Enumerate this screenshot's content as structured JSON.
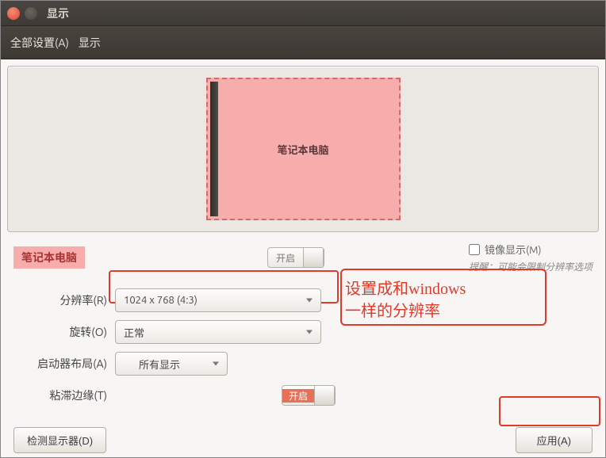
{
  "window": {
    "title": "显示"
  },
  "breadcrumb": {
    "all_settings": "全部设置(A)",
    "current": "显示"
  },
  "preview": {
    "monitor_name": "笔记本电脑"
  },
  "monitor_section": {
    "name": "笔记本电脑",
    "power_label": "开启",
    "mirror_label": "镜像显示(M)",
    "mirror_hint": "提醒：可能会限制分辨率选项"
  },
  "form": {
    "resolution_label": "分辨率(R)",
    "resolution_value": "1024 x 768 (4:3)",
    "rotation_label": "旋转(O)",
    "rotation_value": "正常",
    "launcher_label": "启动器布局(A)",
    "launcher_value": "所有显示",
    "sticky_label": "粘滞边缘(T)",
    "sticky_value": "开启"
  },
  "annotation": {
    "line1": "设置成和windows",
    "line2": "一样的分辨率"
  },
  "buttons": {
    "detect": "检测显示器(D)",
    "apply": "应用(A)"
  }
}
